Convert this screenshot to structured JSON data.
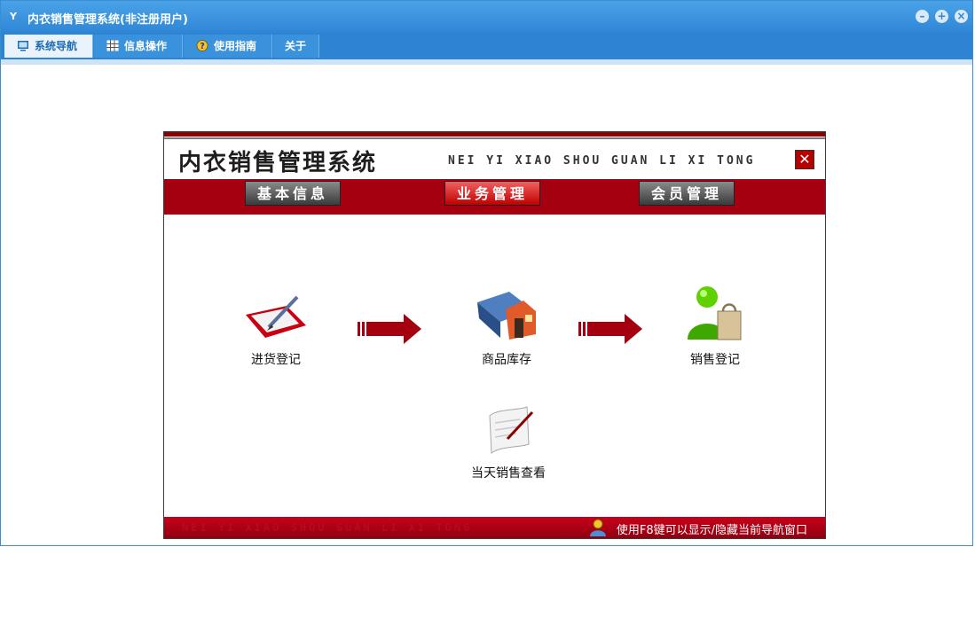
{
  "window": {
    "title": "内衣销售管理系统(非注册用户)",
    "app_icon": "Y"
  },
  "menu": {
    "tabs": [
      {
        "label": "系统导航"
      },
      {
        "label": "信息操作"
      },
      {
        "label": "使用指南"
      },
      {
        "label": "关于"
      }
    ]
  },
  "panel": {
    "title": "内衣销售管理系统",
    "pinyin": "NEI YI XIAO SHOU GUAN LI XI TONG",
    "close_glyph": "✕",
    "modules": [
      "基本信息",
      "业务管理",
      "会员管理"
    ],
    "features": {
      "purchase": "进货登记",
      "stock": "商品库存",
      "sales": "销售登记",
      "daily": "当天销售查看"
    },
    "footer_pinyin": "NEI YI XIAO SHOU GUAN LI XI TONG",
    "footer_tip": "使用F8键可以显示/隐藏当前导航窗口"
  },
  "colors": {
    "accent": "#2c84d2",
    "brand_red": "#a50010"
  },
  "icons": [
    "minimize-icon",
    "restore-icon",
    "close-icon",
    "monitor-icon",
    "grid-icon",
    "help-icon",
    "pen-tablet-icon",
    "warehouse-icon",
    "shopper-icon",
    "scroll-icon",
    "user-tip-icon"
  ]
}
